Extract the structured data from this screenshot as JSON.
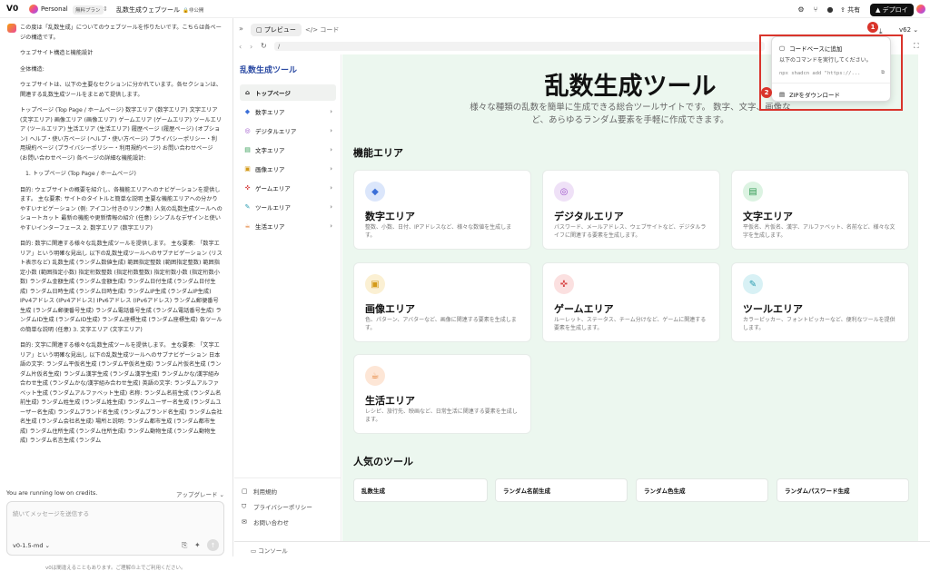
{
  "topbar": {
    "logo": "V0",
    "workspace": "Personal",
    "plan": "無料プラン",
    "project": "乱数生成ウェブツール",
    "visibility": "非公開",
    "share": "共有",
    "deploy": "デプロイ"
  },
  "chat": {
    "paragraphs": [
      "この度は「乱数生成」についてのウェブツールを作りたいです。こちらは各ページの構造です。",
      "ウェブサイト構造と機能設計",
      "全体構造:",
      "ウェブサイトは、以下の主要なセクションに分かれています。各セクションは、関連する乱数生成ツールをまとめて提供します。",
      "トップページ (Top Page / ホームページ) 数字エリア (数字エリア) 文字エリア (文字エリア) 画像エリア (画像エリア) ゲームエリア (ゲームエリア) ツールエリア (ツールエリア) 生活エリア (生活エリア) 履歴ページ (履歴ページ) (オプション) ヘルプ・使い方ページ (ヘルプ・使い方ページ) プライバシーポリシー・利用規約ページ (プライバシーポリシー・利用規約ページ) お問い合わせページ (お問い合わせページ) 各ページの詳細な機能設計:",
      "1. トップページ (Top Page / ホームページ)",
      "目的: ウェブサイトの概要を紹介し、各機能エリアへのナビゲーションを提供します。 主な要素: サイトのタイトルと簡単な説明 主要な機能エリアへの分かりやすいナビゲーション (例: アイコン付きのリンク集) 人気の乱数生成ツールへのショートカット 最新の機能や更新情報の紹介 (任意) シンプルなデザインと使いやすいインターフェース 2. 数字エリア (数字エリア)",
      "目的: 数字に関連する様々な乱数生成ツールを提供します。 主な要素: 「数字エリア」という明確な見出し 以下の乱数生成ツールへのサブナビゲーション (リスト表示など) 乱数生成 (ランダム数値生成) 範囲指定整数 (範囲指定整数) 範囲指定小数 (範囲指定小数) 指定桁数整数 (指定桁数整数) 指定桁数小数 (指定桁数小数) ランダム金額生成 (ランダム金額生成) ランダム日付生成 (ランダム日付生成) ランダム日時生成 (ランダム日時生成) ランダムIP生成 (ランダムIP生成) IPv4アドレス (IPv4アドレス) IPv6アドレス (IPv6アドレス) ランダム郵便番号生成 (ランダム郵便番号生成) ランダム電話番号生成 (ランダム電話番号生成) ランダムID生成 (ランダムID生成) ランダム座標生成 (ランダム座標生成) 各ツールの簡単な説明 (任意) 3. 文字エリア (文字エリア)",
      "目的: 文字に関連する様々な乱数生成ツールを提供します。 主な要素: 「文字エリア」という明確な見出し 以下の乱数生成ツールへのサブナビゲーション 日本語の文字: ランダム平仮名生成 (ランダム平仮名生成) ランダム片仮名生成 (ランダム片仮名生成) ランダム漢字生成 (ランダム漢字生成) ランダムかな/漢字組み合わせ生成 (ランダムかな/漢字組み合わせ生成) 英語の文字: ランダムアルファベット生成 (ランダムアルファベット生成) 名称: ランダム名前生成 (ランダム名前生成) ランダム姓生成 (ランダム姓生成) ランダムユーザー名生成 (ランダムユーザー名生成) ランダムブランド名生成 (ランダムブランド名生成) ランダム会社名生成 (ランダム会社名生成) 場所と説明: ランダム都市生成 (ランダム都市生成) ランダム住所生成 (ランダム住所生成) ランダム動物生成 (ランダム動物生成) ランダム名言生成 (ランダム"
    ],
    "credits": "You are running low on credits.",
    "upgrade": "アップグレード",
    "input_placeholder": "続いてメッセージを送信する",
    "model": "v0-1.5-md",
    "footer_note": "v0は間違えることもあります。ご理解の上でご利用ください。"
  },
  "preview": {
    "tab_preview": "プレビュー",
    "tab_code": "コード",
    "url": "/",
    "version": "v62",
    "console": "コンソール"
  },
  "dropdown": {
    "add_to_codebase": "コードベースに追加",
    "instruction": "以下のコマンドを実行してください。",
    "command": "npx shadcn add \"https://...",
    "download_zip": "ZIPをダウンロード",
    "marker1": "1",
    "marker2": "2"
  },
  "app": {
    "title": "乱数生成ツール",
    "nav": [
      {
        "label": "トップページ",
        "icon": "home-icon"
      },
      {
        "label": "数字エリア",
        "icon": "shapes-icon"
      },
      {
        "label": "デジタルエリア",
        "icon": "globe-icon"
      },
      {
        "label": "文字エリア",
        "icon": "document-icon"
      },
      {
        "label": "画像エリア",
        "icon": "image-icon"
      },
      {
        "label": "ゲームエリア",
        "icon": "gamepad-icon"
      },
      {
        "label": "ツールエリア",
        "icon": "wrench-icon"
      },
      {
        "label": "生活エリア",
        "icon": "coffee-icon"
      }
    ],
    "footer_links": [
      "利用規約",
      "プライバシーポリシー",
      "お問い合わせ"
    ],
    "hero_title": "乱数生成ツール",
    "hero_sub": "様々な種類の乱数を簡単に生成できる総合ツールサイトです。 数字、文字、画像など、あらゆるランダム要素を手軽に作成できます。",
    "features_title": "機能エリア",
    "cards": [
      {
        "title": "数字エリア",
        "desc": "整数、小数、日付、IPアドレスなど、様々な数値を生成します。",
        "icon": "shapes-icon",
        "color": "#dbe6fb",
        "fg": "#3b6fd8"
      },
      {
        "title": "デジタルエリア",
        "desc": "パスワード、メールアドレス、ウェブサイトなど、デジタルライフに関連する要素を生成します。",
        "icon": "globe-icon",
        "color": "#efe1f7",
        "fg": "#9b4fc9"
      },
      {
        "title": "文字エリア",
        "desc": "平仮名、片仮名、漢字、アルファベット、名前など、様々な文字を生成します。",
        "icon": "document-icon",
        "color": "#dcf3e2",
        "fg": "#2f9a52"
      },
      {
        "title": "画像エリア",
        "desc": "色、パターン、アバターなど、画像に関連する要素を生成します。",
        "icon": "image-icon",
        "color": "#fbf0d3",
        "fg": "#d39a1a"
      },
      {
        "title": "ゲームエリア",
        "desc": "ルーレット、ステータス、チーム分けなど、ゲームに関連する要素を生成します。",
        "icon": "gamepad-icon",
        "color": "#fbe0e0",
        "fg": "#d94848"
      },
      {
        "title": "ツールエリア",
        "desc": "カラーピッカー、フォントピッカーなど、便利なツールを提供します。",
        "icon": "wrench-icon",
        "color": "#d8f1f5",
        "fg": "#2a9bb0"
      },
      {
        "title": "生活エリア",
        "desc": "レシピ、旅行先、映画など、日常生活に関連する要素を生成します。",
        "icon": "coffee-icon",
        "color": "#fde6d6",
        "fg": "#e27a2c"
      }
    ],
    "popular_title": "人気のツール",
    "popular": [
      "乱数生成",
      "ランダム名前生成",
      "ランダム色生成",
      "ランダムパスワード生成"
    ]
  }
}
